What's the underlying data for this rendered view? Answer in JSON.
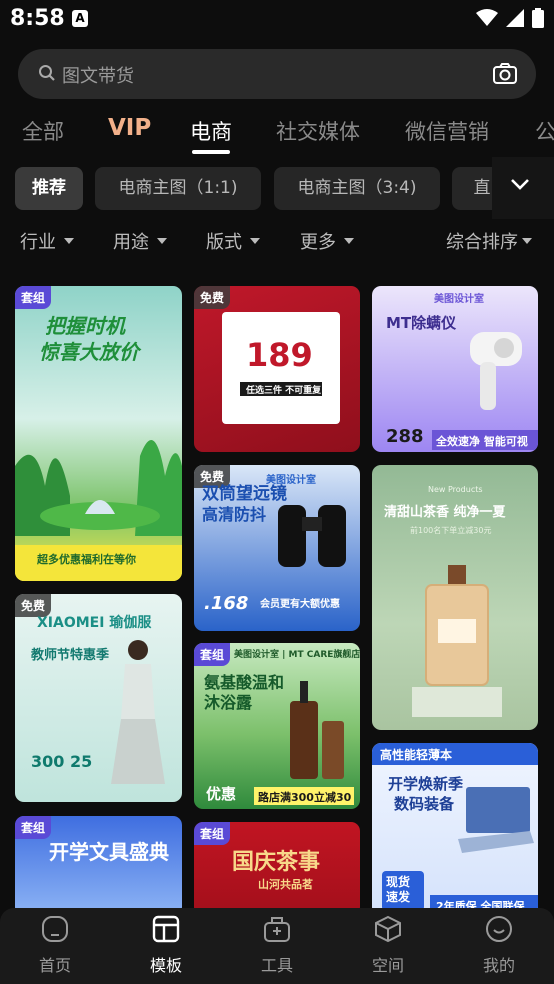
{
  "status": {
    "time": "8:58",
    "app_indicator": "A"
  },
  "search": {
    "placeholder": "图文带货"
  },
  "tabs": [
    {
      "label": "全部"
    },
    {
      "label": "VIP"
    },
    {
      "label": "电商"
    },
    {
      "label": "社交媒体"
    },
    {
      "label": "微信营销"
    },
    {
      "label": "公"
    }
  ],
  "chips": [
    {
      "label": "推荐"
    },
    {
      "label": "电商主图（1:1)"
    },
    {
      "label": "电商主图（3:4)"
    },
    {
      "label": "直"
    }
  ],
  "filters": {
    "industry": "行业",
    "purpose": "用途",
    "layout": "版式",
    "more": "更多",
    "sort": "综合排序"
  },
  "cards": {
    "c1": {
      "badge": "套组",
      "title1": "把握时机",
      "title2": "惊喜大放价",
      "foot": "超多优惠福利在等你"
    },
    "c2": {
      "badge": "免费",
      "price": "189",
      "sub": "任选三件 不可重复"
    },
    "c3": {
      "brand": "美图设计室",
      "title": "MT除螨仪",
      "price": "288",
      "foot": "全效速净 智能可视"
    },
    "c4": {
      "badge": "免费",
      "brand": "美图设计室",
      "title1": "双筒望远镜",
      "title2": "高清防抖",
      "price": ".168",
      "foot": "会员更有大额优惠"
    },
    "c5": {
      "top": "New Products",
      "title": "清甜山茶香 纯净一夏",
      "sub": "前100名下单立减30元"
    },
    "c6": {
      "badge": "免费",
      "title": "XIAOMEI 瑜伽服",
      "sub": "教师节特惠季",
      "nums": "300  25"
    },
    "c7": {
      "badge": "套组",
      "brand": "美图设计室 | MT CARE旗舰店",
      "title1": "氨基酸温和",
      "title2": "沐浴露",
      "foot": "路店满300立减30",
      "foot_left": "优惠"
    },
    "c8": {
      "tag": "高性能轻薄本",
      "title1": "开学焕新季",
      "title2": "数码装备",
      "foot_left": "现货速发",
      "foot": "2年质保 全国联保"
    },
    "c9": {
      "badge": "套组",
      "title": "开学文具盛典"
    },
    "c10": {
      "badge": "套组",
      "title": "国庆茶事",
      "sub": "山河共品茗"
    }
  },
  "nav": [
    {
      "label": "首页"
    },
    {
      "label": "模板"
    },
    {
      "label": "工具"
    },
    {
      "label": "空间"
    },
    {
      "label": "我的"
    }
  ]
}
